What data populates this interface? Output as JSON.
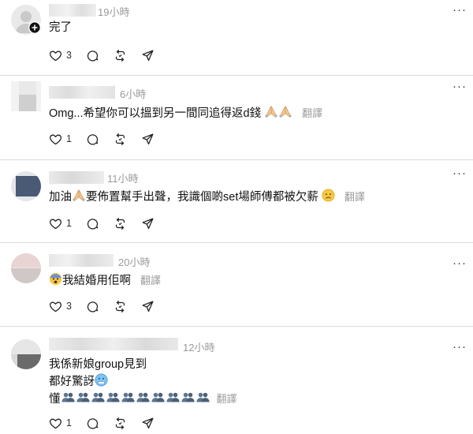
{
  "posts": [
    {
      "time": "19小時",
      "lines": [
        "完了"
      ],
      "likes": "3"
    },
    {
      "time": "6小時",
      "lines": [
        "Omg...希望你可以搵到另一間同追得返d錢"
      ],
      "translate": "翻譯",
      "likes": "1"
    },
    {
      "time": "11小時",
      "lines": [
        "加油",
        "要佈置幫手出聲，我識個啲set場師傅都被欠薪"
      ],
      "translate": "翻譯",
      "likes": "1"
    },
    {
      "time": "20小時",
      "lines": [
        "我結婚用佢啊"
      ],
      "translate": "翻譯",
      "likes": "3"
    },
    {
      "time": "12小時",
      "lines": [
        "我係新娘group見到",
        "都好驚訝",
        "懂"
      ],
      "translate": "翻譯",
      "likes": "1"
    }
  ],
  "icons": [
    "heart-icon",
    "comment-icon",
    "repost-icon",
    "share-icon",
    "more-icon",
    "add-badge-icon",
    "praying-hands-emoji",
    "fearful-face-emoji",
    "cold-face-emoji",
    "people-silhouette-emoji",
    "sad-face-emoji"
  ]
}
